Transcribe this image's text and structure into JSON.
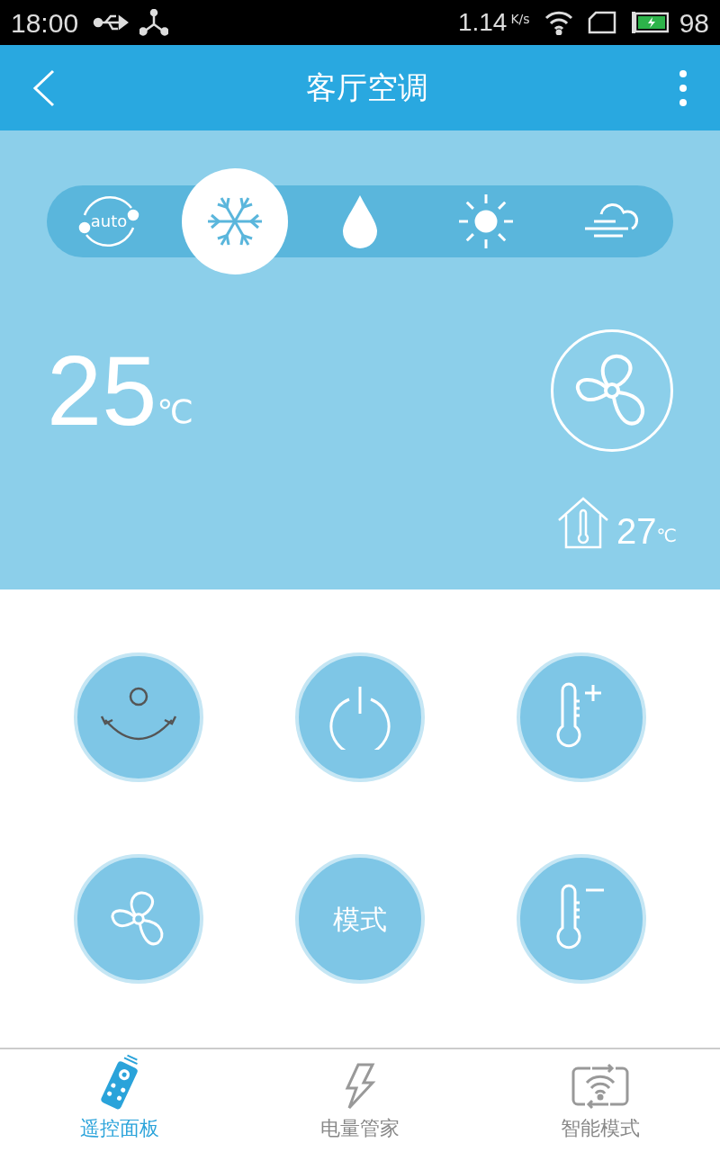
{
  "status_bar": {
    "time": "18:00",
    "speed": "1.14",
    "speed_unit": "K/s",
    "battery": "98"
  },
  "header": {
    "title": "客厅空调"
  },
  "modes": [
    {
      "kind": "auto",
      "label": "auto",
      "selected": false
    },
    {
      "kind": "cool",
      "selected": true
    },
    {
      "kind": "dry",
      "selected": false
    },
    {
      "kind": "heat",
      "selected": false
    },
    {
      "kind": "fan",
      "selected": false
    }
  ],
  "set_temperature": {
    "value": "25",
    "unit": "℃"
  },
  "indoor_temperature": {
    "value": "27",
    "unit": "℃"
  },
  "controls": [
    {
      "kind": "swing"
    },
    {
      "kind": "power"
    },
    {
      "kind": "temp_up"
    },
    {
      "kind": "fan"
    },
    {
      "kind": "mode",
      "label": "模式"
    },
    {
      "kind": "temp_down"
    }
  ],
  "tabs": [
    {
      "kind": "remote",
      "label": "遥控面板",
      "selected": true
    },
    {
      "kind": "power",
      "label": "电量管家",
      "selected": false
    },
    {
      "kind": "smart",
      "label": "智能模式",
      "selected": false
    }
  ]
}
